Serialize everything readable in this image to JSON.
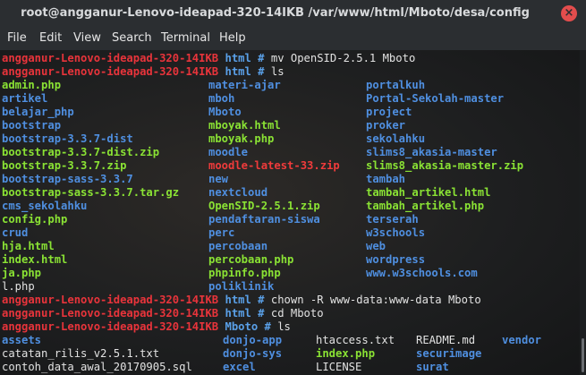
{
  "window": {
    "title": "root@angganur-Lenovo-ideapad-320-14IKB /var/www/html/Mboto/desa/config",
    "close_glyph": "×"
  },
  "menu": [
    "File",
    "Edit",
    "View",
    "Search",
    "Terminal",
    "Help"
  ],
  "terminal": {
    "colors": {
      "prompt_host": "#e8343b",
      "prompt_dir": "#5aa0e8",
      "directory": "#5aa0e8",
      "executable_file": "#8ae234",
      "archive": "#ef3b3b",
      "plain": "#e2e2e2"
    },
    "host": "angganur-Lenovo-ideapad-320-14IKB",
    "prompts": [
      {
        "dir": "html",
        "sym": "#",
        "cmd": "mv OpenSID-2.5.1 Mboto"
      },
      {
        "dir": "html",
        "sym": "#",
        "cmd": "ls"
      },
      {
        "dir": "html",
        "sym": "#",
        "cmd": "chown -R www-data:www-data Mboto"
      },
      {
        "dir": "html",
        "sym": "#",
        "cmd": "cd Mboto"
      },
      {
        "dir": "Mboto",
        "sym": "#",
        "cmd": "ls"
      }
    ],
    "ls_html": [
      [
        "admin.php",
        "materi-ajar",
        "portalkuh"
      ],
      [
        "artikel",
        "mboh",
        "Portal-Sekolah-master"
      ],
      [
        "belajar_php",
        "Mboto",
        "project"
      ],
      [
        "bootstrap",
        "mboyak.html",
        "proker"
      ],
      [
        "bootstrap-3.3.7-dist",
        "mboyak.php",
        "sekolahku"
      ],
      [
        "bootstrap-3.3.7-dist.zip",
        "moodle",
        "slims8_akasia-master"
      ],
      [
        "bootstrap-3.3.7.zip",
        "moodle-latest-33.zip",
        "slims8_akasia-master.zip"
      ],
      [
        "bootstrap-sass-3.3.7",
        "new",
        "tambah"
      ],
      [
        "bootstrap-sass-3.3.7.tar.gz",
        "nextcloud",
        "tambah_artikel.html"
      ],
      [
        "cms_sekolahku",
        "OpenSID-2.5.1.zip",
        "tambah_artikel.php"
      ],
      [
        "config.php",
        "pendaftaran-siswa",
        "terserah"
      ],
      [
        "crud",
        "perc",
        "w3schools"
      ],
      [
        "hja.html",
        "percobaan",
        "web"
      ],
      [
        "index.html",
        "percobaan.php",
        "wordpress"
      ],
      [
        "ja.php",
        "phpinfo.php",
        "www.w3schools.com"
      ],
      [
        "l.php",
        "poliklinik",
        ""
      ]
    ],
    "ls_mboto": [
      [
        "assets",
        "donjo-app",
        "htaccess.txt",
        "README.md",
        "vendor"
      ],
      [
        "catatan_rilis_v2.5.1.txt",
        "donjo-sys",
        "index.php",
        "securimage",
        ""
      ],
      [
        "contoh_data_awal_20170905.sql",
        "excel",
        "LICENSE",
        "surat",
        ""
      ]
    ]
  }
}
